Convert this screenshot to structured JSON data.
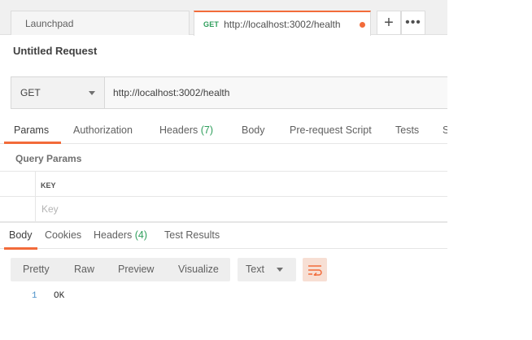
{
  "tabs": {
    "launchpad_label": "Launchpad",
    "active_method": "GET",
    "active_url": "http://localhost:3002/health",
    "add_label": "+",
    "more_label": "•••"
  },
  "request": {
    "title": "Untitled Request",
    "method": "GET",
    "url": "http://localhost:3002/health"
  },
  "request_tabs": [
    {
      "label": "Params"
    },
    {
      "label": "Authorization"
    },
    {
      "label": "Headers",
      "count": "(7)"
    },
    {
      "label": "Body"
    },
    {
      "label": "Pre-request Script"
    },
    {
      "label": "Tests"
    },
    {
      "label": "S"
    }
  ],
  "query_params": {
    "heading": "Query Params",
    "key_header": "KEY",
    "key_placeholder": "Key"
  },
  "response_tabs": [
    {
      "label": "Body"
    },
    {
      "label": "Cookies"
    },
    {
      "label": "Headers",
      "count": "(4)"
    },
    {
      "label": "Test Results"
    }
  ],
  "response_views": [
    "Pretty",
    "Raw",
    "Preview",
    "Visualize"
  ],
  "response_format": "Text",
  "response_body": {
    "line_number": "1",
    "text": "OK"
  },
  "colors": {
    "accent": "#f26b3a",
    "count_green": "#2e9e5b"
  }
}
